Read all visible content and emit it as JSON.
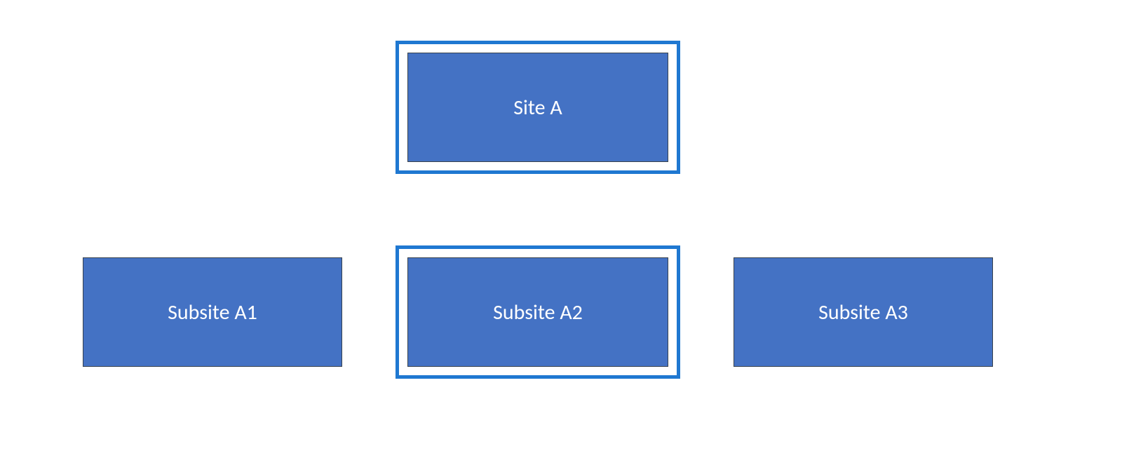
{
  "diagram": {
    "nodes": {
      "siteA": {
        "label": "Site A",
        "highlighted": true
      },
      "subA1": {
        "label": "Subsite A1",
        "highlighted": false
      },
      "subA2": {
        "label": "Subsite A2",
        "highlighted": true
      },
      "subA3": {
        "label": "Subsite A3",
        "highlighted": false
      }
    },
    "colors": {
      "fill": "#4472c4",
      "border": "#38424d",
      "highlight": "#1f78d1",
      "text": "#ffffff"
    }
  }
}
